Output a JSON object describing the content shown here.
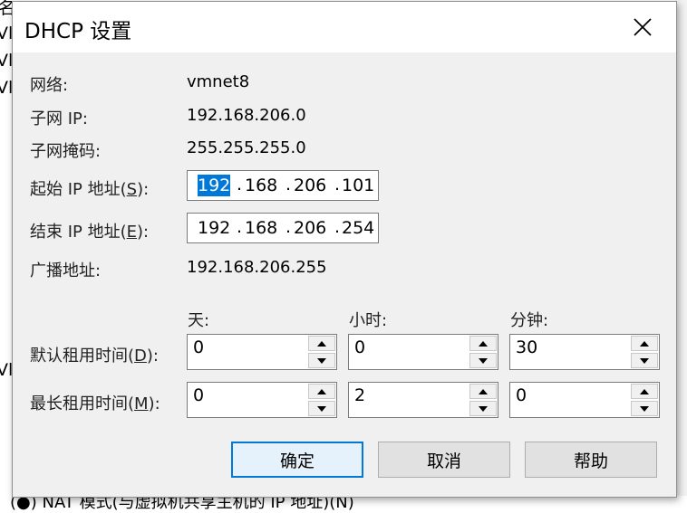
{
  "background": {
    "fragments": [
      "名",
      "Vl",
      "Vl",
      "Vl",
      "Vl"
    ],
    "bottom_text": "(●) NAT 模式(与虚拟机共享主机的 IP 地址)(N)"
  },
  "dialog": {
    "title": "DHCP 设置",
    "network_label": "网络:",
    "network_value": "vmnet8",
    "subnet_ip_label": "子网 IP:",
    "subnet_ip_value": "192.168.206.0",
    "subnet_mask_label": "子网掩码:",
    "subnet_mask_value": "255.255.255.0",
    "start_ip": {
      "label_pre": "起始 IP 地址(",
      "mnemonic": "S",
      "label_post": "):",
      "octets": [
        "192",
        "168",
        "206",
        "101"
      ]
    },
    "end_ip": {
      "label_pre": "结束 IP 地址(",
      "mnemonic": "E",
      "label_post": "):",
      "octets": [
        "192",
        "168",
        "206",
        "254"
      ]
    },
    "broadcast_label": "广播地址:",
    "broadcast_value": "192.168.206.255",
    "col_days": "天:",
    "col_hours": "小时:",
    "col_minutes": "分钟:",
    "default_lease": {
      "label_pre": "默认租用时间(",
      "mnemonic": "D",
      "label_post": "):",
      "days": "0",
      "hours": "0",
      "minutes": "30"
    },
    "max_lease": {
      "label_pre": "最长租用时间(",
      "mnemonic": "M",
      "label_post": "):",
      "days": "0",
      "hours": "2",
      "minutes": "0"
    },
    "buttons": {
      "ok": "确定",
      "cancel": "取消",
      "help": "帮助"
    }
  },
  "colors": {
    "accent": "#0078d7",
    "dialog_bg": "#f0f0f0"
  },
  "icons": {
    "close": "close-icon",
    "up": "chevron-up-icon",
    "down": "chevron-down-icon"
  }
}
